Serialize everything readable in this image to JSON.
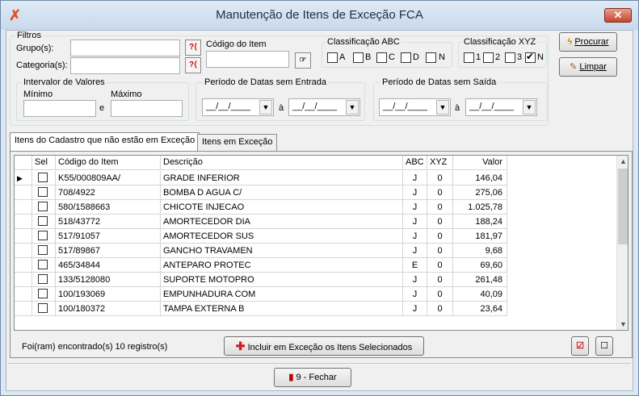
{
  "window": {
    "title": "Manutenção de Itens de Exceção FCA"
  },
  "filters": {
    "group_label": "Filtros",
    "grupo_label": "Grupo(s):",
    "categoria_label": "Categoria(s):",
    "codigo_label": "Código do Item",
    "abc_label": "Classificação ABC",
    "abc_options": [
      {
        "label": "A",
        "checked": false
      },
      {
        "label": "B",
        "checked": false
      },
      {
        "label": "C",
        "checked": false
      },
      {
        "label": "D",
        "checked": false
      },
      {
        "label": "N",
        "checked": false
      }
    ],
    "xyz_label": "Classificação XYZ",
    "xyz_options": [
      {
        "label": "1",
        "checked": false
      },
      {
        "label": "2",
        "checked": false
      },
      {
        "label": "3",
        "checked": false
      },
      {
        "label": "N",
        "checked": true
      }
    ],
    "valores_label": "Intervalor de Valores",
    "minimo_label": "Mínimo",
    "maximo_label": "Máximo",
    "e_label": "e",
    "entrada_label": "Período de Datas sem Entrada",
    "saida_label": "Período de Datas sem Saída",
    "date_placeholder": "__/__/____",
    "a_label": "à"
  },
  "buttons": {
    "procurar": "Procurar",
    "limpar": "Limpar",
    "incluir": "Incluir em Exceção os Itens Selecionados",
    "fechar": "9 - Fechar"
  },
  "tabs": [
    {
      "label": "Itens do Cadastro que não estão em Exceção",
      "active": true
    },
    {
      "label": "Itens em Exceção",
      "active": false
    }
  ],
  "grid": {
    "columns": [
      "Sel",
      "Código do Item",
      "Descrição",
      "ABC",
      "XYZ",
      "Valor"
    ],
    "rows": [
      {
        "codigo": "K55/000809AA/",
        "descricao": "GRADE  INFERIOR",
        "abc": "J",
        "xyz": "0",
        "valor": "146,04"
      },
      {
        "codigo": "708/4922",
        "descricao": "BOMBA D AGUA C/",
        "abc": "J",
        "xyz": "0",
        "valor": "275,06"
      },
      {
        "codigo": "580/1588663",
        "descricao": "CHICOTE INJECAO",
        "abc": "J",
        "xyz": "0",
        "valor": "1.025,78"
      },
      {
        "codigo": "518/43772",
        "descricao": "AMORTECEDOR DIA",
        "abc": "J",
        "xyz": "0",
        "valor": "188,24"
      },
      {
        "codigo": "517/91057",
        "descricao": "AMORTECEDOR SUS",
        "abc": "J",
        "xyz": "0",
        "valor": "181,97"
      },
      {
        "codigo": "517/89867",
        "descricao": "GANCHO TRAVAMEN",
        "abc": "J",
        "xyz": "0",
        "valor": "9,68"
      },
      {
        "codigo": "465/34844",
        "descricao": "ANTEPARO PROTEC",
        "abc": "E",
        "xyz": "0",
        "valor": "69,60"
      },
      {
        "codigo": "133/5128080",
        "descricao": "SUPORTE MOTOPRO",
        "abc": "J",
        "xyz": "0",
        "valor": "261,48"
      },
      {
        "codigo": "100/193069",
        "descricao": "EMPUNHADURA COM",
        "abc": "J",
        "xyz": "0",
        "valor": "40,09"
      },
      {
        "codigo": "100/180372",
        "descricao": "TAMPA EXTERNA B",
        "abc": "J",
        "xyz": "0",
        "valor": "23,64"
      }
    ]
  },
  "status": {
    "found_text": "Foi(ram) encontrado(s) 10 registro(s)"
  },
  "icons": {
    "app": "app-logo-icon",
    "question": "help-query-icon",
    "search": "lightning-search-icon",
    "clear": "eraser-icon",
    "plus": "red-plus-icon",
    "exit": "exit-door-icon",
    "pick": "hand-pick-icon"
  },
  "colors": {
    "accent_red": "#d21f1f"
  }
}
